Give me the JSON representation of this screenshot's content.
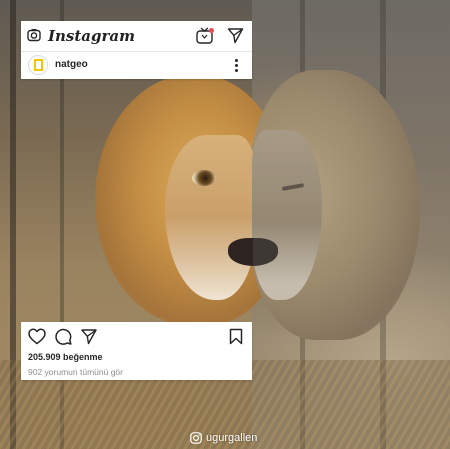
{
  "app": {
    "name": "Instagram"
  },
  "header": {
    "camera_icon": "camera-icon",
    "igtv_icon": "igtv-icon",
    "direct_icon": "paper-plane-icon"
  },
  "post": {
    "username": "natgeo",
    "avatar_icon": "national-geographic-logo",
    "more_icon": "more-vertical-icon",
    "likes": "205.909 beğenme",
    "comments_link": "902 yorumun tümünü gör"
  },
  "actions": {
    "like_icon": "heart-icon",
    "comment_icon": "comment-icon",
    "share_icon": "paper-plane-icon",
    "save_icon": "bookmark-icon"
  },
  "watermark": {
    "icon": "instagram-icon",
    "handle": "ugurgallen"
  },
  "colors": {
    "card_bg": "#ffffff",
    "text_primary": "#262626",
    "text_secondary": "#8e8e8e",
    "igtv_accent": "#ed4956"
  }
}
